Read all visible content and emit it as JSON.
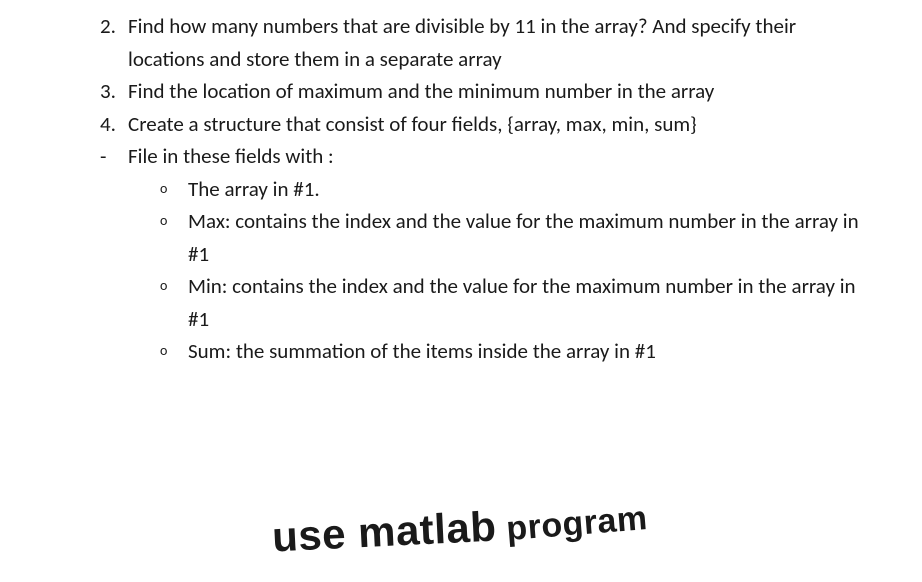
{
  "items": [
    {
      "marker": "2.",
      "text": "Find how many numbers that are divisible by 11 in the array? And specify their locations and store them in a separate array"
    },
    {
      "marker": "3.",
      "text": "Find the location of maximum and the minimum number in the array"
    },
    {
      "marker": "4.",
      "text": "Create a structure that consist of four fields, {array, max, min, sum}"
    }
  ],
  "dash": {
    "marker": "-",
    "text": "File in these fields with :"
  },
  "subitems": [
    {
      "marker": "o",
      "text": "The array in #1."
    },
    {
      "marker": "o",
      "text": "Max: contains the index and the value for the maximum number in the array in #1"
    },
    {
      "marker": "o",
      "text": "Min: contains the index and the value for the maximum number in the array in #1"
    },
    {
      "marker": "o",
      "text": "Sum: the summation of the items inside the array in #1"
    }
  ],
  "footer": {
    "main": "use matlab",
    "program": "program"
  }
}
